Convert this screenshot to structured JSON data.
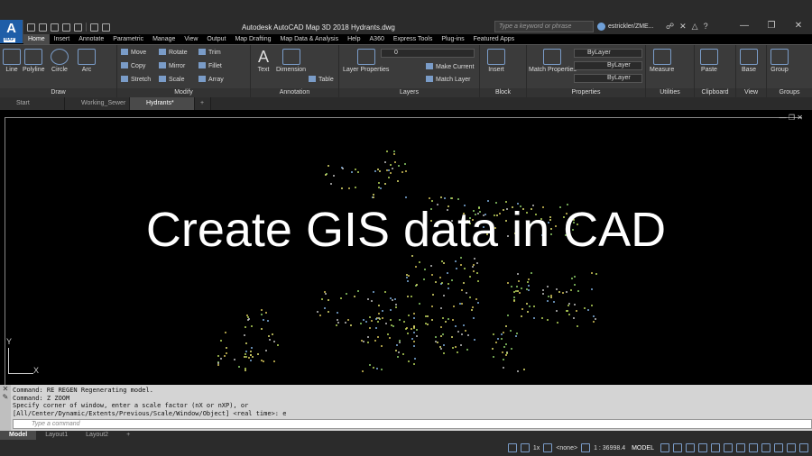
{
  "window": {
    "title": "Autodesk AutoCAD Map 3D 2018   Hydrants.dwg",
    "app_letter": "A",
    "app_badge": "MAP",
    "search_placeholder": "Type a keyword or phrase",
    "user": "estrickler/ZME..."
  },
  "ribbon_tabs": [
    "Home",
    "Insert",
    "Annotate",
    "Parametric",
    "Manage",
    "View",
    "Output",
    "Map Drafting",
    "Map Data & Analysis",
    "Help",
    "A360",
    "Express Tools",
    "Plug-ins",
    "Featured Apps"
  ],
  "active_ribbon_tab": "Home",
  "panels": {
    "draw": {
      "label": "Draw",
      "tools": [
        "Line",
        "Polyline",
        "Circle",
        "Arc"
      ]
    },
    "modify": {
      "label": "Modify",
      "tools": [
        "Move",
        "Rotate",
        "Trim",
        "Copy",
        "Mirror",
        "Fillet",
        "Stretch",
        "Scale",
        "Array"
      ]
    },
    "annotation": {
      "label": "Annotation",
      "tools": [
        "Text",
        "Dimension",
        "Table"
      ]
    },
    "layers": {
      "label": "Layers",
      "tools": [
        "Layer Properties",
        "Make Current",
        "Match Layer"
      ],
      "current_layer": "0"
    },
    "block": {
      "label": "Block",
      "tools": [
        "Insert"
      ]
    },
    "properties": {
      "label": "Properties",
      "tools": [
        "Match Properties"
      ],
      "color": "ByLayer",
      "linetype": "ByLayer",
      "lineweight": "ByLayer"
    },
    "utilities": {
      "label": "Utilities",
      "tools": [
        "Measure"
      ]
    },
    "clipboard": {
      "label": "Clipboard",
      "tools": [
        "Paste"
      ]
    },
    "view": {
      "label": "View",
      "tools": [
        "Base"
      ]
    },
    "groups": {
      "label": "Groups",
      "tools": [
        "Group"
      ]
    }
  },
  "file_tabs": [
    "Start",
    "Working_Sewer",
    "Hydrants*"
  ],
  "active_file_tab": "Hydrants*",
  "overlay_title": "Create GIS data in CAD",
  "ucs": {
    "x": "X",
    "y": "Y"
  },
  "command_history": [
    "Command: RE REGEN Regenerating model.",
    "Command: Z ZOOM",
    "Specify corner of window, enter a scale factor (nX or nXP), or",
    "[All/Center/Dynamic/Extents/Previous/Scale/Window/Object] <real time>: e"
  ],
  "command_placeholder": "Type a command",
  "layout_tabs": [
    "Model",
    "Layout1",
    "Layout2"
  ],
  "active_layout": "Model",
  "status": {
    "scale_factor": "1x",
    "selection": "<none>",
    "annotation_scale": "1 : 36998.4",
    "space": "MODEL"
  }
}
